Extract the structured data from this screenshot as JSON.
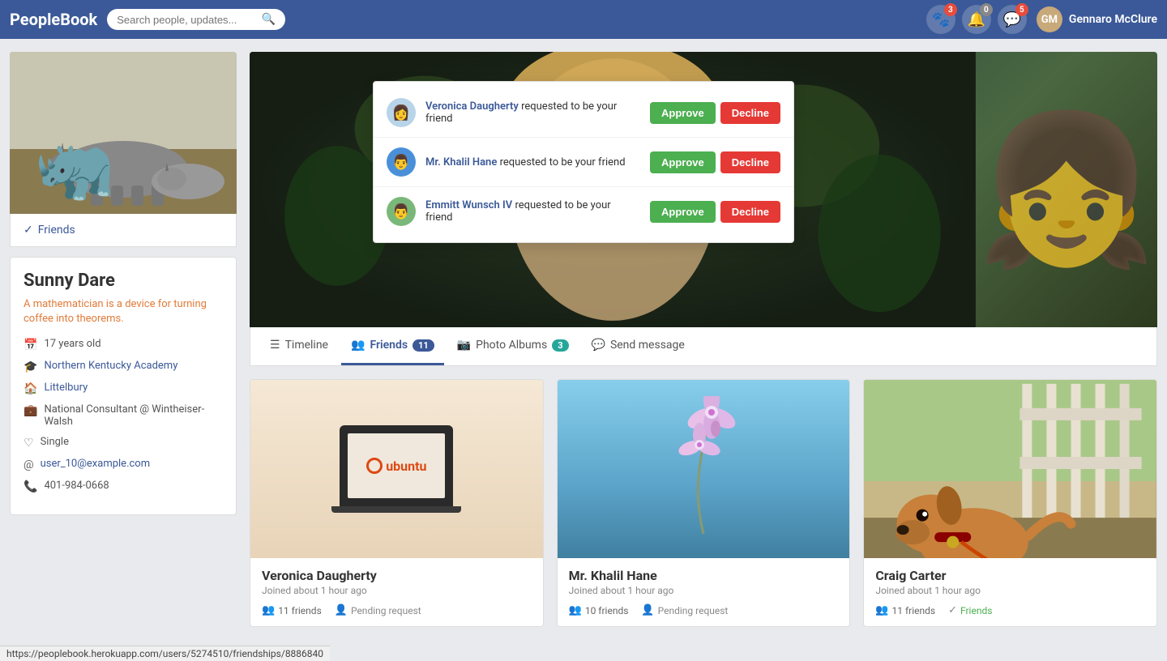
{
  "app": {
    "brand": "PeopleBook",
    "search_placeholder": "Search people, updates...",
    "nav_badges": {
      "friends_count": "3",
      "notif_count": "0",
      "messages_count": "5"
    },
    "user": {
      "name": "Gennaro McClure"
    }
  },
  "notifications": {
    "requests": [
      {
        "id": "v",
        "name": "Veronica Daugherty",
        "text": "requested to be your friend",
        "approve_label": "Approve",
        "decline_label": "Decline"
      },
      {
        "id": "k",
        "name": "Mr. Khalil Hane",
        "text": "requested to be your friend",
        "approve_label": "Approve",
        "decline_label": "Decline"
      },
      {
        "id": "e",
        "name": "Emmitt Wunsch IV",
        "text": "requested to be your friend",
        "approve_label": "Approve",
        "decline_label": "Decline"
      }
    ]
  },
  "profile": {
    "name": "Sunny Dare",
    "bio": "A mathematician is a device for turning coffee into theorems.",
    "friends_label": "Friends",
    "info": {
      "age": "17 years old",
      "school": "Northern Kentucky Academy",
      "location": "Littelbury",
      "job": "National Consultant @ Wintheiser-Walsh",
      "relationship": "Single",
      "email": "user_10@example.com",
      "phone": "401-984-0668"
    }
  },
  "tabs": [
    {
      "id": "timeline",
      "label": "Timeline",
      "badge": null,
      "active": false
    },
    {
      "id": "friends",
      "label": "Friends",
      "badge": "11",
      "active": true
    },
    {
      "id": "photo-albums",
      "label": "Photo Albums",
      "badge": "3",
      "active": false
    },
    {
      "id": "send-message",
      "label": "Send message",
      "badge": null,
      "active": false
    }
  ],
  "friends": [
    {
      "name": "Veronica Daugherty",
      "joined": "Joined about 1 hour ago",
      "friends_count": "11 friends",
      "status": "Pending request",
      "photo_type": "ubuntu"
    },
    {
      "name": "Mr. Khalil Hane",
      "joined": "Joined about 1 hour ago",
      "friends_count": "10 friends",
      "status": "Pending request",
      "photo_type": "orchid"
    },
    {
      "name": "Craig Carter",
      "joined": "Joined about 1 hour ago",
      "friends_count": "11 friends",
      "status": "Friends",
      "photo_type": "dog"
    }
  ],
  "status_bar": {
    "url": "https://peoplebook.herokuapp.com/users/5274510/friendships/8886840"
  }
}
